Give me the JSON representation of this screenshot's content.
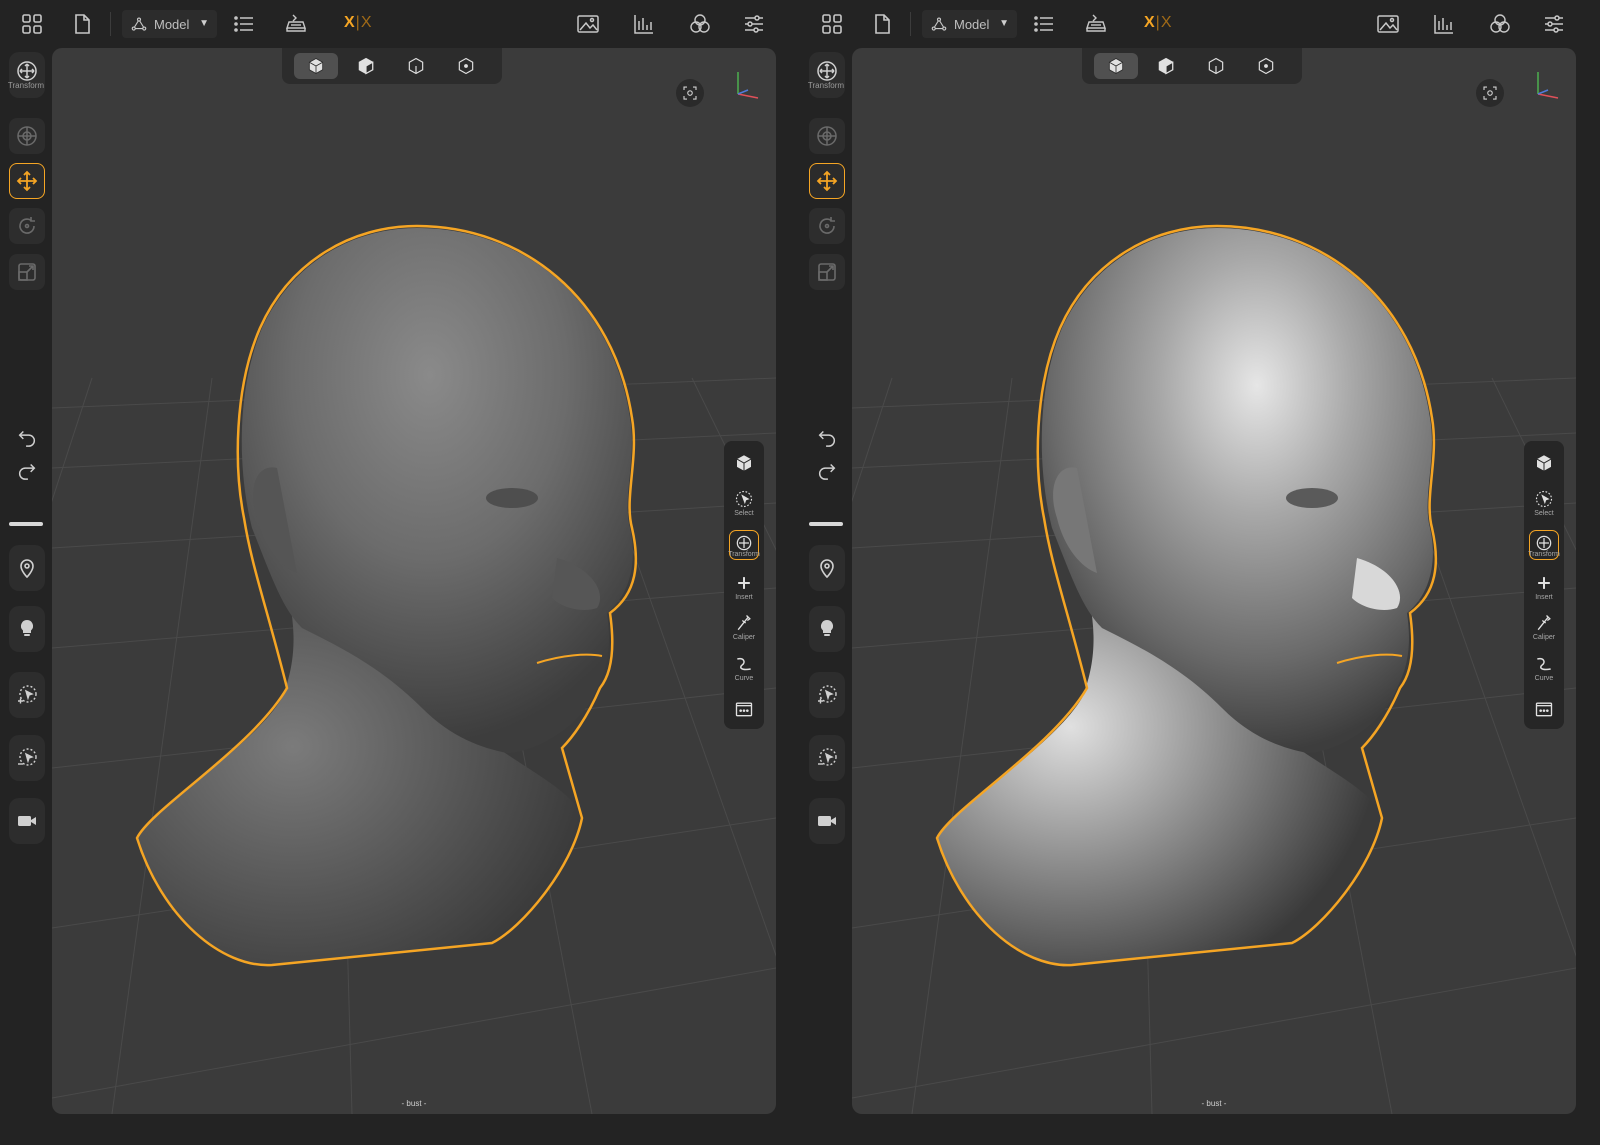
{
  "panes": [
    {
      "id": "left",
      "toolbar": {
        "mode_label": "Model",
        "xx_primary": "X",
        "xx_secondary": "X"
      },
      "sidebar": {
        "transform_label": "Transform"
      },
      "right_tools": [
        {
          "icon": "cube-icon",
          "label": ""
        },
        {
          "icon": "select-icon",
          "label": "Select"
        },
        {
          "icon": "transform-icon",
          "label": "Transform"
        },
        {
          "icon": "insert-icon",
          "label": "Insert"
        },
        {
          "icon": "caliper-icon",
          "label": "Caliper"
        },
        {
          "icon": "curve-icon",
          "label": "Curve"
        },
        {
          "icon": "more-icon",
          "label": ""
        }
      ],
      "status_text": "- bust -",
      "shading": "matte"
    },
    {
      "id": "right",
      "toolbar": {
        "mode_label": "Model",
        "xx_primary": "X",
        "xx_secondary": "X"
      },
      "sidebar": {
        "transform_label": "Transform"
      },
      "right_tools": [
        {
          "icon": "cube-icon",
          "label": ""
        },
        {
          "icon": "select-icon",
          "label": "Select"
        },
        {
          "icon": "transform-icon",
          "label": "Transform"
        },
        {
          "icon": "insert-icon",
          "label": "Insert"
        },
        {
          "icon": "caliper-icon",
          "label": "Caliper"
        },
        {
          "icon": "curve-icon",
          "label": "Curve"
        },
        {
          "icon": "more-icon",
          "label": ""
        }
      ],
      "status_text": "- bust -",
      "shading": "glossy"
    }
  ],
  "colors": {
    "accent": "#f5a524",
    "viewport_bg": "#3b3b3b",
    "chrome": "#232323"
  }
}
